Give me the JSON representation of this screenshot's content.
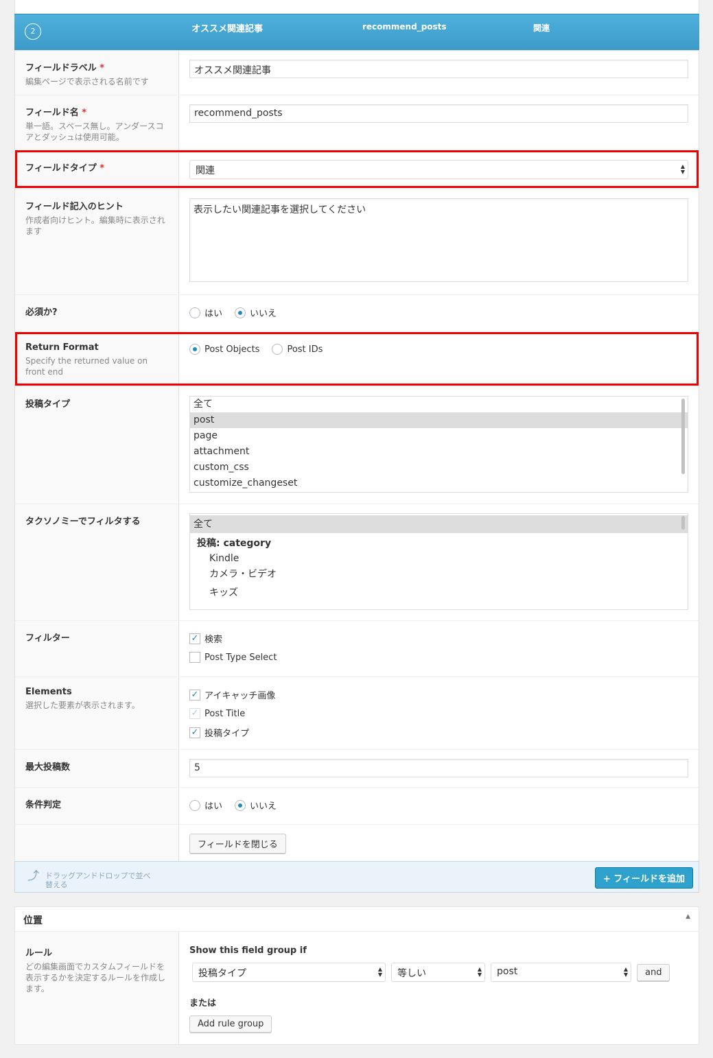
{
  "header": {
    "number": "2",
    "label": "オススメ関連記事",
    "name": "recommend_posts",
    "type": "関連"
  },
  "fields": {
    "label": {
      "title": "フィールドラベル",
      "desc": "編集ページで表示される名前です",
      "value": "オススメ関連記事"
    },
    "name": {
      "title": "フィールド名",
      "desc": "単一語。スペース無し。アンダースコアとダッシュは使用可能。",
      "value": "recommend_posts"
    },
    "type": {
      "title": "フィールドタイプ",
      "value": "関連"
    },
    "hint": {
      "title": "フィールド記入のヒント",
      "desc": "作成者向けヒント。編集時に表示されます",
      "value": "表示したい関連記事を選択してください"
    },
    "required": {
      "title": "必須か?",
      "options": [
        "はい",
        "いいえ"
      ],
      "selected": "いいえ"
    },
    "return_format": {
      "title": "Return Format",
      "desc": "Specify the returned value on front end",
      "options": [
        "Post Objects",
        "Post IDs"
      ],
      "selected": "Post Objects"
    },
    "post_type": {
      "title": "投稿タイプ",
      "items": [
        "全て",
        "post",
        "page",
        "attachment",
        "custom_css",
        "customize_changeset"
      ],
      "selected": "post"
    },
    "taxonomy": {
      "title": "タクソノミーでフィルタする",
      "items": [
        "全て",
        "投稿: category",
        "Kindle",
        "カメラ・ビデオ",
        "キッズ"
      ],
      "selected": "全て"
    },
    "filter": {
      "title": "フィルター",
      "items": [
        {
          "label": "検索",
          "checked": true
        },
        {
          "label": "Post Type Select",
          "checked": false
        }
      ]
    },
    "elements": {
      "title": "Elements",
      "desc": "選択した要素が表示されます。",
      "items": [
        {
          "label": "アイキャッチ画像",
          "checked": true
        },
        {
          "label": "Post Title",
          "checked": true,
          "disabled": true
        },
        {
          "label": "投稿タイプ",
          "checked": true
        }
      ]
    },
    "max": {
      "title": "最大投稿数",
      "value": "5"
    },
    "conditional": {
      "title": "条件判定",
      "options": [
        "はい",
        "いいえ"
      ],
      "selected": "いいえ"
    },
    "close_button": "フィールドを閉じる"
  },
  "footer": {
    "hint": "ドラッグアンドドロップで並べ替える",
    "add_button": "+ フィールドを追加"
  },
  "location": {
    "title": "位置",
    "rules_title": "ルール",
    "rules_desc": "どの編集画面でカスタムフィールドを表示するかを決定するルールを作成します。",
    "show_if": "Show this field group if",
    "param": "投稿タイプ",
    "operator": "等しい",
    "value": "post",
    "and_button": "and",
    "or_label": "または",
    "add_group_button": "Add rule group"
  }
}
